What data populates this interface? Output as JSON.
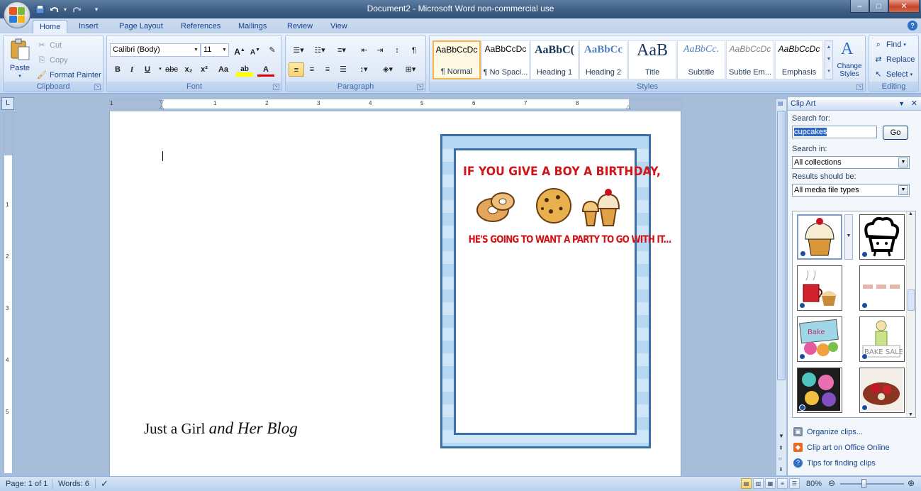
{
  "window": {
    "title": "Document2 - Microsoft Word non-commercial use",
    "controls": {
      "minimize": "–",
      "maximize": "□",
      "close": "✕"
    }
  },
  "quick_access": {
    "save_icon": "save-icon",
    "undo_icon": "undo-icon",
    "redo_icon": "redo-icon",
    "customize": "▾"
  },
  "tabs": [
    {
      "label": "Home",
      "active": true
    },
    {
      "label": "Insert"
    },
    {
      "label": "Page Layout"
    },
    {
      "label": "References"
    },
    {
      "label": "Mailings"
    },
    {
      "label": "Review"
    },
    {
      "label": "View"
    }
  ],
  "ribbon": {
    "clipboard": {
      "label": "Clipboard",
      "paste": "Paste",
      "cut": "Cut",
      "copy": "Copy",
      "format_painter": "Format Painter"
    },
    "font": {
      "label": "Font",
      "font_name": "Calibri (Body)",
      "font_size": "11",
      "bold": "B",
      "italic": "I",
      "underline": "U",
      "strike": "abc",
      "subscript": "x₂",
      "superscript": "x²",
      "change_case": "Aa",
      "grow": "A",
      "shrink": "A",
      "highlight": "ab",
      "color": "A"
    },
    "paragraph": {
      "label": "Paragraph"
    },
    "styles": {
      "label": "Styles",
      "items": [
        {
          "sample": "AaBbCcDc",
          "name": "¶ Normal",
          "selected": true
        },
        {
          "sample": "AaBbCcDc",
          "name": "¶ No Spaci..."
        },
        {
          "sample": "AaBbC(",
          "name": "Heading 1"
        },
        {
          "sample": "AaBbCc",
          "name": "Heading 2"
        },
        {
          "sample": "AaB",
          "name": "Title"
        },
        {
          "sample": "AaBbCc.",
          "name": "Subtitle"
        },
        {
          "sample": "AaBbCcDc",
          "name": "Subtle Em..."
        },
        {
          "sample": "AaBbCcDc",
          "name": "Emphasis"
        }
      ],
      "change_styles": "Change Styles"
    },
    "editing": {
      "label": "Editing",
      "find": "Find",
      "replace": "Replace",
      "select": "Select"
    }
  },
  "ruler": {
    "h_numbers": [
      "1",
      "1",
      "2",
      "3",
      "4",
      "5",
      "6",
      "7",
      "8"
    ],
    "v_numbers": [
      "1",
      "2",
      "3",
      "4",
      "5"
    ]
  },
  "document": {
    "signature_plain": "Just a Girl",
    "signature_script": "and Her Blog",
    "invite_line1": "IF YOU GIVE A BOY A BIRTHDAY,",
    "invite_line2": "HE'S GOING TO WANT A PARTY TO GO WITH IT..."
  },
  "clip_art": {
    "title": "Clip Art",
    "search_for_label": "Search for:",
    "search_value": "cupcakes",
    "go": "Go",
    "search_in_label": "Search in:",
    "search_in_value": "All collections",
    "results_label": "Results should be:",
    "results_value": "All media file types",
    "results": [
      {
        "name": "cupcake-clip"
      },
      {
        "name": "cupcake-face-clip"
      },
      {
        "name": "coffee-cupcake-clip"
      },
      {
        "name": "bake-sale-banner-clip"
      },
      {
        "name": "bake-sale-sign-clip"
      },
      {
        "name": "bake-sale-person-clip"
      },
      {
        "name": "colorful-cupcakes-clip"
      },
      {
        "name": "strawberry-cupcake-photo"
      }
    ],
    "links": {
      "organize": "Organize clips...",
      "online": "Clip art on Office Online",
      "tips": "Tips for finding clips"
    }
  },
  "status": {
    "page": "Page: 1 of 1",
    "words": "Words: 6",
    "zoom": "80%"
  }
}
